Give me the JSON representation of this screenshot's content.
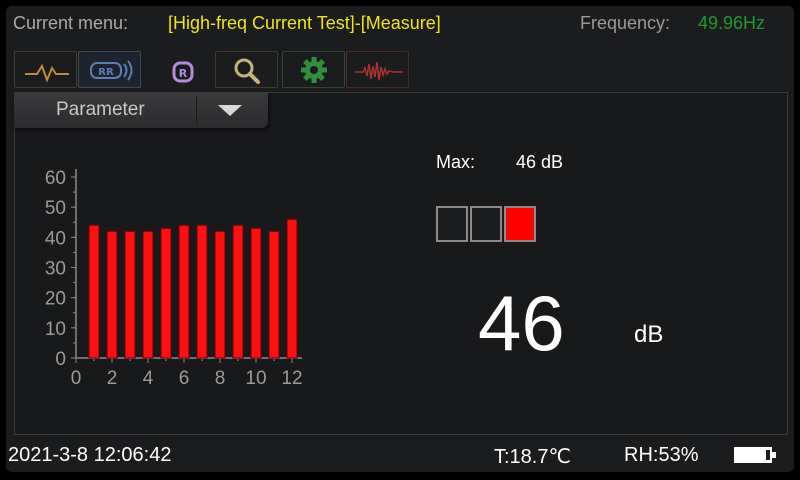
{
  "header": {
    "current_menu_label": "Current menu:",
    "current_menu_value": "[High-freq Current Test]-[Measure]",
    "frequency_label": "Frequency:",
    "frequency_value": "49.96Hz"
  },
  "tabs": [
    {
      "name": "waveform",
      "icon": "waveform-icon",
      "color": "#c08a3a"
    },
    {
      "name": "signal",
      "icon": "rr-signal-icon",
      "color": "#5a7fb0",
      "text": "RR"
    },
    {
      "name": "r-mode",
      "icon": "r-circle-icon",
      "color": "#b58ad8",
      "text": "R"
    },
    {
      "name": "search",
      "icon": "search-icon",
      "color": "#c7b37a"
    },
    {
      "name": "settings",
      "icon": "gear-icon",
      "color": "#2f8f3a"
    },
    {
      "name": "spectrum",
      "icon": "noise-wave-icon",
      "color": "#b03030"
    }
  ],
  "parameter_dropdown": {
    "label": "Parameter"
  },
  "chart_data": {
    "type": "bar",
    "x": [
      1,
      2,
      3,
      4,
      5,
      6,
      7,
      8,
      9,
      10,
      11,
      12
    ],
    "values": [
      44,
      42,
      42,
      42,
      43,
      44,
      44,
      42,
      44,
      43,
      42,
      46
    ],
    "x_ticks": [
      "0",
      "2",
      "4",
      "6",
      "8",
      "10",
      "12"
    ],
    "y_ticks": [
      "0",
      "10",
      "20",
      "30",
      "40",
      "50",
      "60"
    ],
    "xlim": [
      0,
      12
    ],
    "ylim": [
      0,
      60
    ],
    "bar_color": "#ff1010",
    "grid": false
  },
  "measurement": {
    "max_label": "Max:",
    "max_value": "46 dB",
    "value": "46",
    "unit": "dB",
    "level_indicator": [
      "off",
      "off",
      "on"
    ],
    "level_on_color": "#ff0000"
  },
  "status": {
    "datetime": "2021-3-8 12:06:42",
    "temperature": "T:18.7℃",
    "humidity": "RH:53%",
    "battery_icon": "battery-icon"
  }
}
